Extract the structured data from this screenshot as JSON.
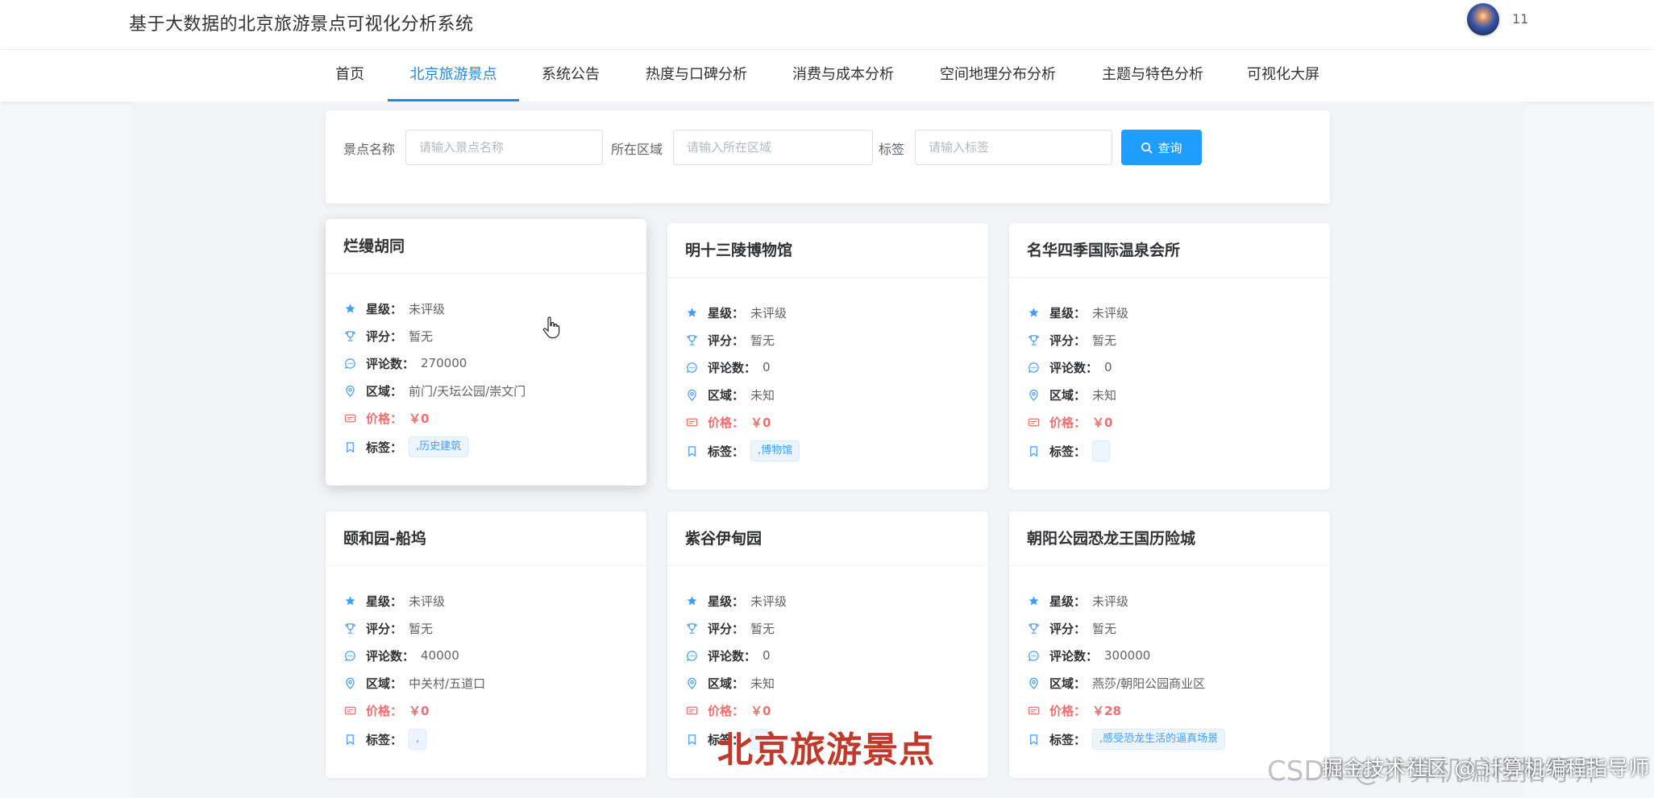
{
  "app": {
    "title": "基于大数据的北京旅游景点可视化分析系统",
    "username": "11"
  },
  "nav": {
    "items": [
      {
        "label": "首页",
        "active": false
      },
      {
        "label": "北京旅游景点",
        "active": true
      },
      {
        "label": "系统公告",
        "active": false
      },
      {
        "label": "热度与口碑分析",
        "active": false
      },
      {
        "label": "消费与成本分析",
        "active": false
      },
      {
        "label": "空间地理分布分析",
        "active": false
      },
      {
        "label": "主题与特色分析",
        "active": false
      },
      {
        "label": "可视化大屏",
        "active": false
      }
    ]
  },
  "search": {
    "name_label": "景点名称",
    "name_placeholder": "请输入景点名称",
    "region_label": "所在区域",
    "region_placeholder": "请输入所在区域",
    "tag_label": "标签",
    "tag_placeholder": "请输入标签",
    "button_label": "查询"
  },
  "field_labels": {
    "stars": "星级：",
    "score": "评分：",
    "reviews": "评论数：",
    "region": "区域：",
    "price": "价格：",
    "tags": "标签："
  },
  "cards": [
    {
      "name": "烂缦胡同",
      "stars": "未评级",
      "score": "暂无",
      "reviews": "270000",
      "region": "前门/天坛公园/崇文门",
      "price": "￥0",
      "tag": ",历史建筑"
    },
    {
      "name": "明十三陵博物馆",
      "stars": "未评级",
      "score": "暂无",
      "reviews": "0",
      "region": "未知",
      "price": "￥0",
      "tag": ",博物馆"
    },
    {
      "name": "名华四季国际温泉会所",
      "stars": "未评级",
      "score": "暂无",
      "reviews": "0",
      "region": "未知",
      "price": "￥0",
      "tag": ""
    },
    {
      "name": "颐和园-船坞",
      "stars": "未评级",
      "score": "暂无",
      "reviews": "40000",
      "region": "中关村/五道口",
      "price": "￥0",
      "tag": ","
    },
    {
      "name": "紫谷伊甸园",
      "stars": "未评级",
      "score": "暂无",
      "reviews": "0",
      "region": "未知",
      "price": "￥0",
      "tag": ""
    },
    {
      "name": "朝阳公园恐龙王国历险城",
      "stars": "未评级",
      "score": "暂无",
      "reviews": "300000",
      "region": "燕莎/朝阳公园商业区",
      "price": "￥28",
      "tag": ",感受恐龙生活的逼真场景"
    }
  ],
  "icons": {
    "stars": "star-icon",
    "score": "trophy-icon",
    "reviews": "comment-icon",
    "region": "location-icon",
    "price": "ticket-icon",
    "tags": "bookmark-icon"
  },
  "colors": {
    "accent": "#1e88e5",
    "button": "#1e9fff",
    "price": "#f56c6c"
  },
  "overlay": {
    "caption": "北京旅游景点",
    "watermark": "CSDN @计算机编程指导师",
    "watermark_overlay": "掘金技术社区 @ 计算机编程指导师"
  }
}
